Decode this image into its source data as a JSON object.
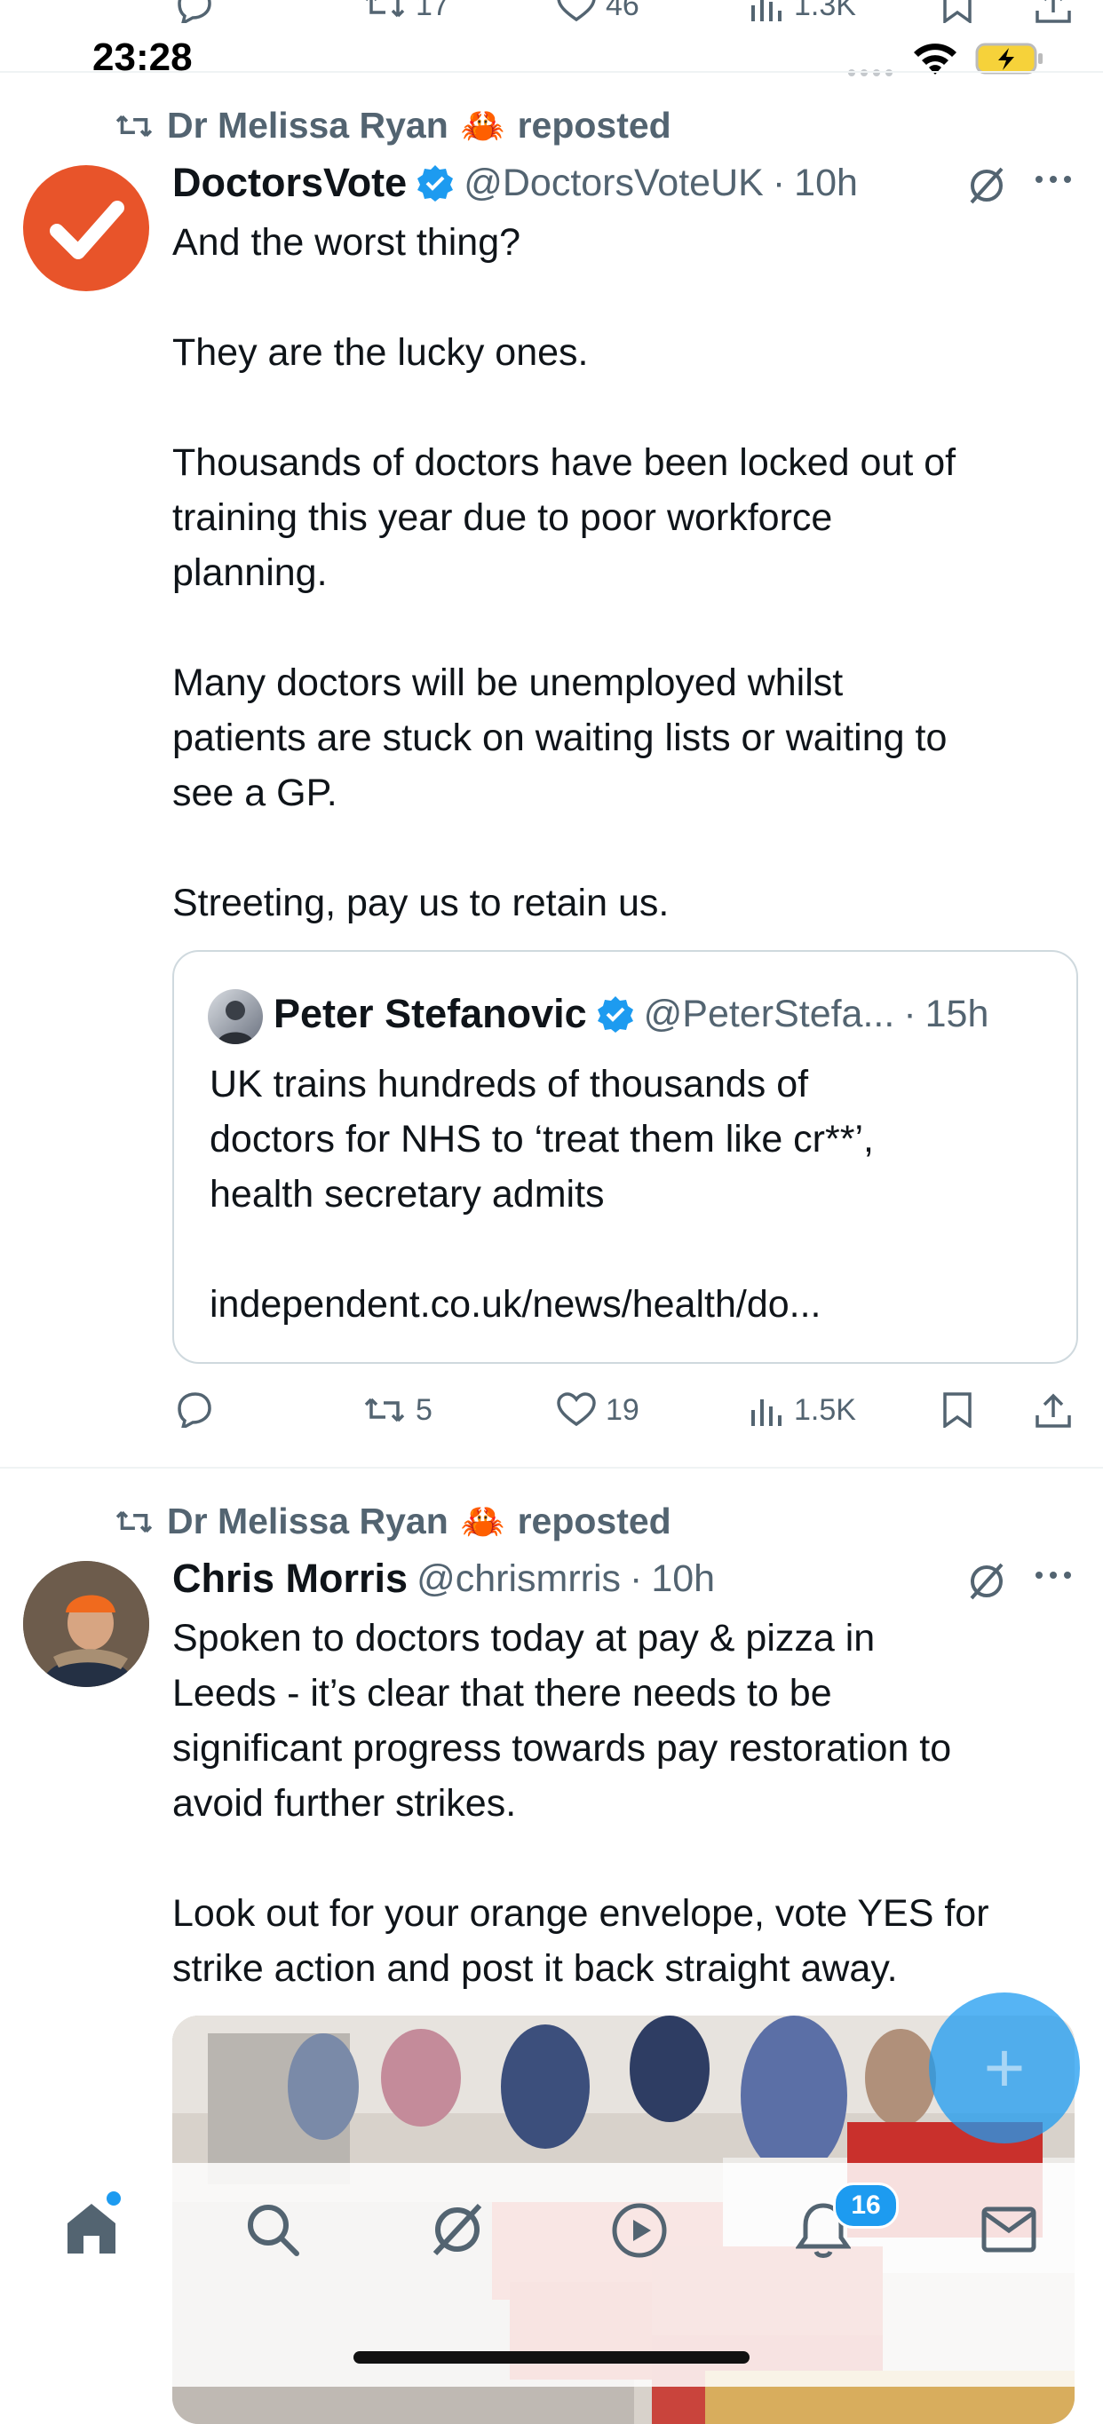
{
  "status_bar": {
    "time": "23:28",
    "icons": [
      "signal-dots",
      "wifi-icon",
      "battery-charging-icon"
    ]
  },
  "prev_actions": {
    "retweets": "17",
    "likes": "46",
    "views": "1.3K"
  },
  "tweets": [
    {
      "repost_by": "Dr Melissa Ryan",
      "repost_emoji": "🦀",
      "repost_label": "reposted",
      "name": "DoctorsVote",
      "verified": true,
      "handle": "@DoctorsVoteUK",
      "dot": "·",
      "time": "10h",
      "text": "And the worst thing?\n\nThey are the lucky ones.\n\nThousands of doctors have been locked out of\ntraining this year due to poor workforce\nplanning.\n\nMany doctors will be unemployed whilst\npatients are stuck on waiting lists or waiting to\nsee a GP.\n\nStreeting, pay us to retain us.",
      "quote": {
        "name": "Peter Stefanovic",
        "verified": true,
        "handle": "@PeterStefa...",
        "dot": "·",
        "time": "15h",
        "text": "UK trains hundreds of thousands of\ndoctors for NHS to ‘treat them like cr**’,\nhealth secretary admits\n\nindependent.co.uk/news/health/do..."
      },
      "actions": {
        "replies": "",
        "retweets": "5",
        "likes": "19",
        "views": "1.5K"
      }
    },
    {
      "repost_by": "Dr Melissa Ryan",
      "repost_emoji": "🦀",
      "repost_label": "reposted",
      "name": "Chris Morris",
      "verified": false,
      "handle": "@chrismrris",
      "dot": "·",
      "time": "10h",
      "text": "Spoken to doctors today at pay & pizza in\nLeeds - it’s clear that there needs to be\nsignificant progress towards pay restoration to\navoid further strikes.\n\nLook out for your orange envelope, vote YES for\nstrike action and post it back straight away."
    }
  ],
  "fab": {
    "label": "+"
  },
  "tabbar": {
    "items": [
      "home-icon",
      "search-icon",
      "grok-icon",
      "play-icon",
      "notifications-icon",
      "messages-icon"
    ],
    "notification_badge": "16"
  },
  "colors": {
    "accent": "#1d9bf0",
    "verified": "#1d9bf0",
    "doctorsvote_avatar": "#e8542a",
    "text": "#0f1419",
    "muted": "#536471"
  }
}
